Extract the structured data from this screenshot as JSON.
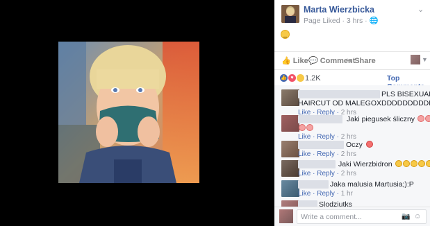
{
  "post": {
    "author": "Marta Wierzbicka",
    "meta": "Page Liked · 3 hrs · ",
    "globe_icon": "globe-icon",
    "chevron_icon": "chevron-down-icon"
  },
  "actions": {
    "like": "Like",
    "comment": "Comment",
    "share": "Share"
  },
  "reactions": {
    "count": "1.2K",
    "top_comments": "Top Comments ▾",
    "icons": [
      "like-icon",
      "love-icon",
      "wow-icon"
    ]
  },
  "comments": [
    {
      "text": "PLS BISEXUAL",
      "text2": "HAIRCUT OD MALEGOXDDDDDDDDDDD",
      "like": "Like",
      "reply": "Reply",
      "time": "2 hrs"
    },
    {
      "text": "Jaki piegusek śliczny",
      "like": "Like",
      "reply": "Reply",
      "time": "2 hrs"
    },
    {
      "text": "Oczy",
      "like": "Like",
      "reply": "Reply",
      "time": "2 hrs"
    },
    {
      "text": "Jaki Wierzbidron",
      "like": "Like",
      "reply": "Reply",
      "time": "2 hrs"
    },
    {
      "text": "Jaka malusia Martusia;):P",
      "like": "Like",
      "reply": "Reply",
      "time": "1 hr"
    },
    {
      "text": "Slodziutks"
    }
  ],
  "composer": {
    "placeholder": "Write a comment..."
  }
}
